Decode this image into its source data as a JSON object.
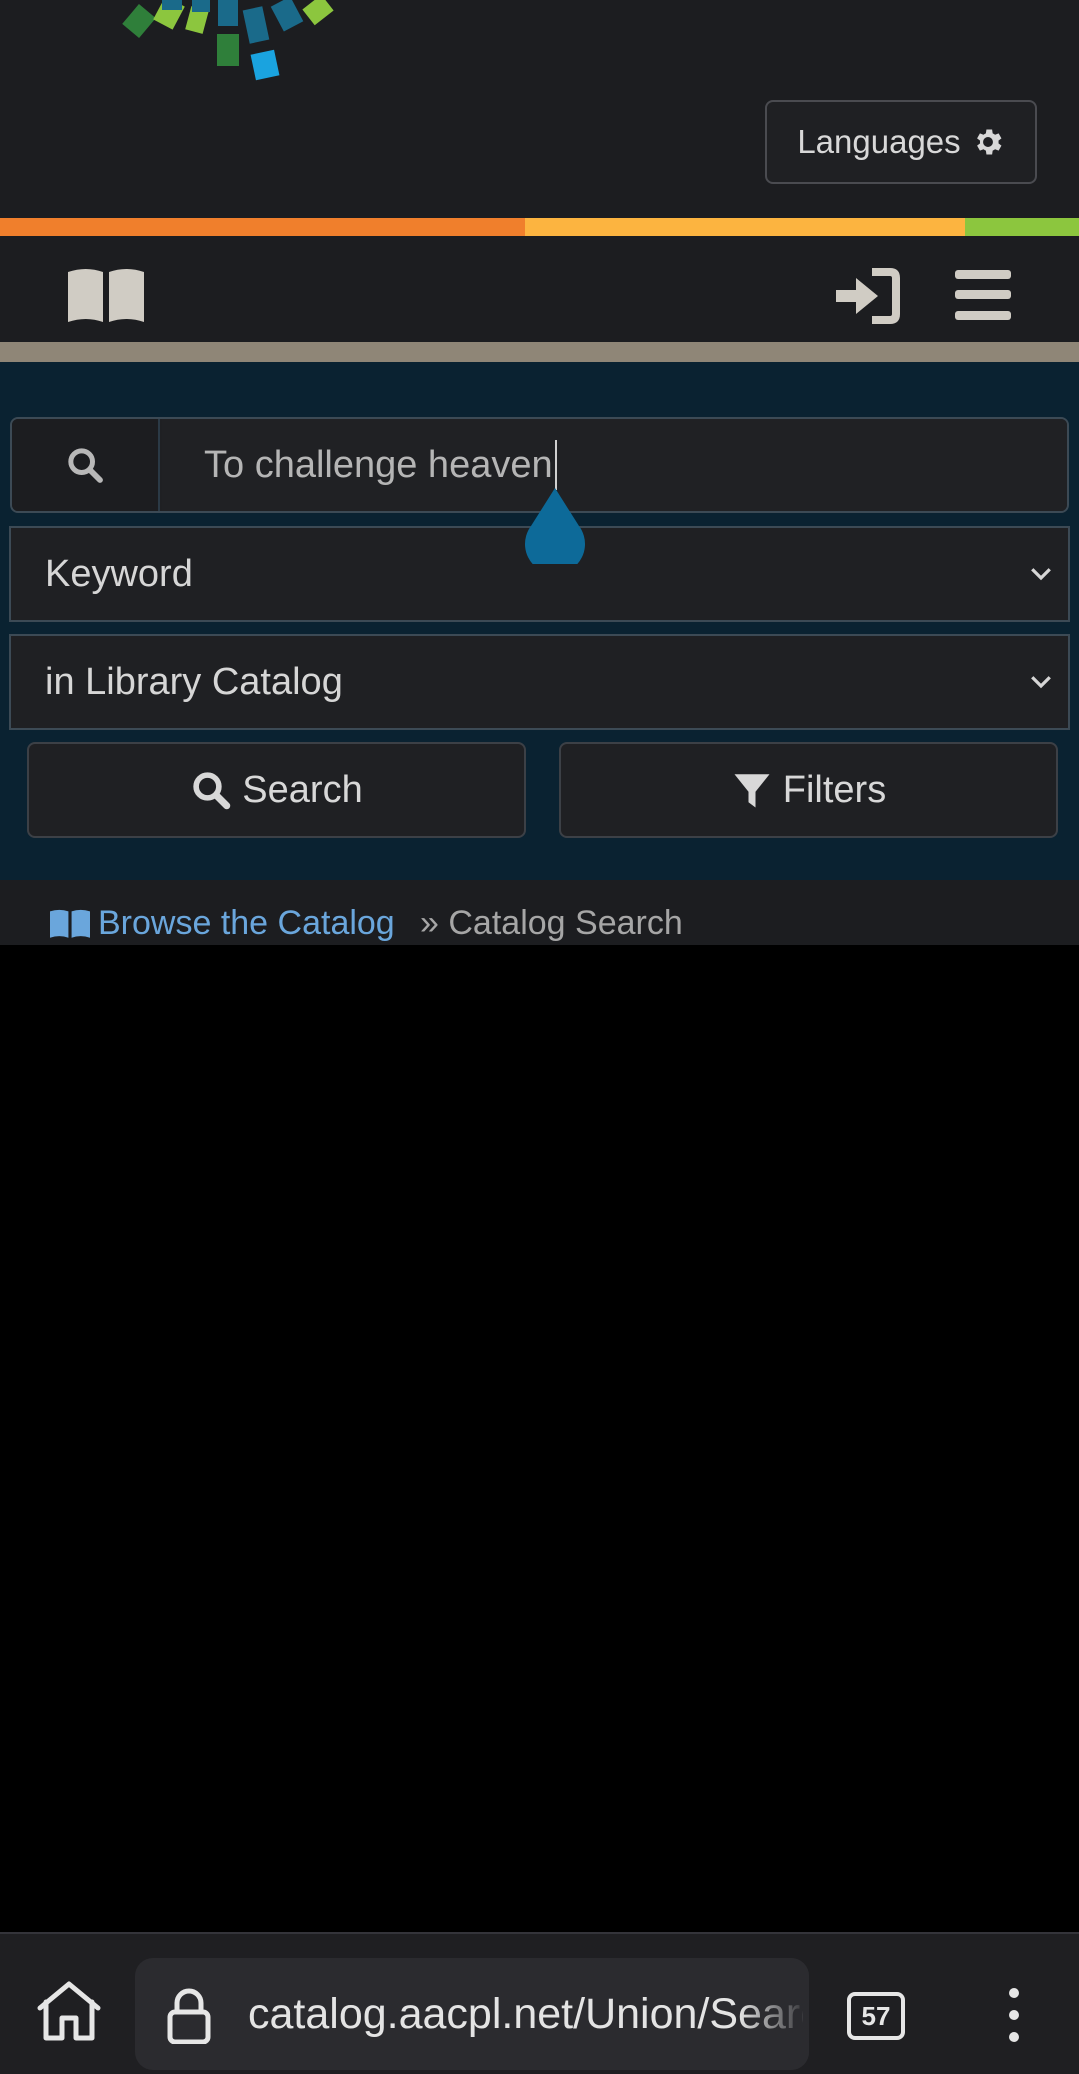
{
  "header": {
    "languages_label": "Languages",
    "gear_icon": "gear-icon"
  },
  "stripe_colors": [
    "#f07f2c",
    "#fcb440",
    "#8cc63e"
  ],
  "navbar": {
    "book_icon": "book-icon",
    "login_icon": "sign-in-icon",
    "menu_icon": "hamburger-menu-icon"
  },
  "search": {
    "query": "To challenge heaven",
    "search_type": "Keyword",
    "search_source": "in Library Catalog",
    "search_button": "Search",
    "filters_button": "Filters"
  },
  "breadcrumb": {
    "link": "Browse the Catalog",
    "separator": "»",
    "current": "Catalog Search"
  },
  "browser": {
    "url": "catalog.aacpl.net/Union/Search",
    "tab_count": "57"
  },
  "colors": {
    "accent_link": "#6aa6dc",
    "search_bg": "#0a2231",
    "cursor_handle": "#0d6a99"
  }
}
